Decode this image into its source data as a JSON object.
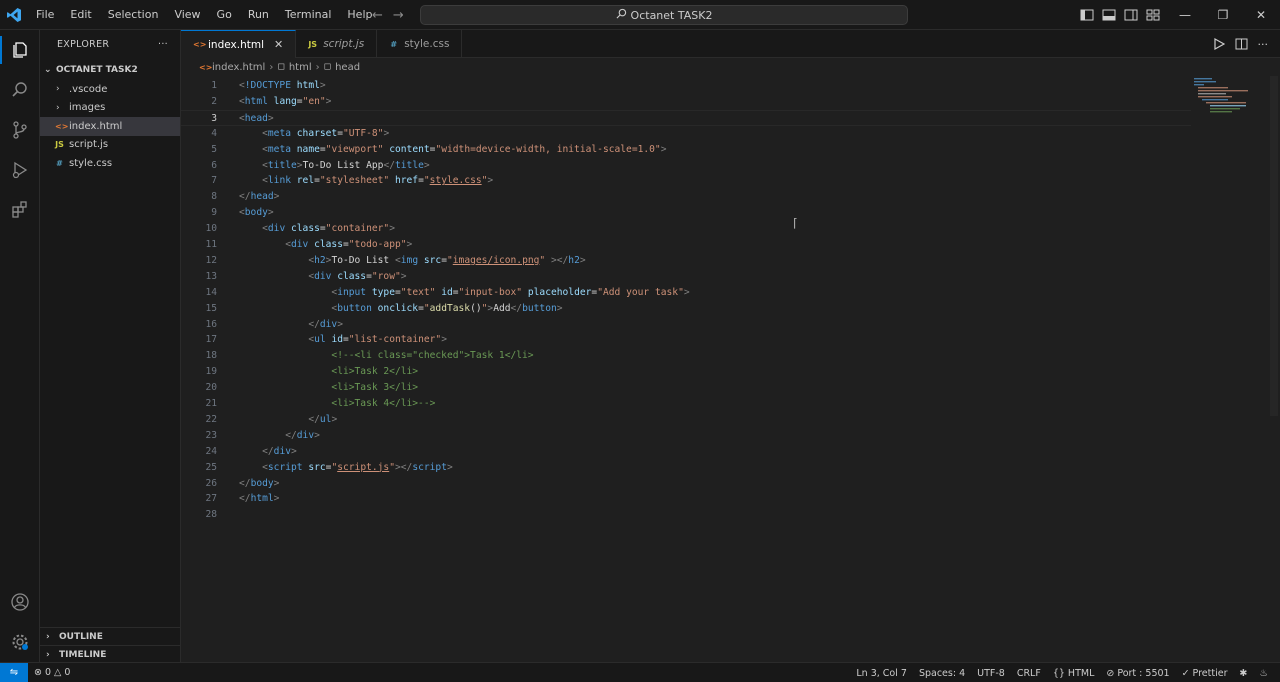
{
  "titlebar": {
    "menu": [
      "File",
      "Edit",
      "Selection",
      "View",
      "Go",
      "Run",
      "Terminal",
      "Help"
    ],
    "search_text": "Octanet TASK2"
  },
  "sidebar": {
    "title": "EXPLORER",
    "more": "···",
    "folder": "OCTANET TASK2",
    "items": [
      {
        "label": ".vscode",
        "kind": "folder"
      },
      {
        "label": "images",
        "kind": "folder"
      },
      {
        "label": "index.html",
        "kind": "html"
      },
      {
        "label": "script.js",
        "kind": "js"
      },
      {
        "label": "style.css",
        "kind": "css"
      }
    ],
    "outline": "OUTLINE",
    "timeline": "TIMELINE"
  },
  "tabs": [
    {
      "label": "index.html",
      "icon": "html",
      "active": true
    },
    {
      "label": "script.js",
      "icon": "js",
      "active": false
    },
    {
      "label": "style.css",
      "icon": "css",
      "active": false
    }
  ],
  "breadcrumb": [
    "index.html",
    "html",
    "head"
  ],
  "editor": {
    "lines": [
      [
        [
          "t-punc",
          "<"
        ],
        [
          "t-tag",
          "!DOCTYPE"
        ],
        [
          "t-txt",
          " "
        ],
        [
          "t-attr",
          "html"
        ],
        [
          "t-punc",
          ">"
        ]
      ],
      [
        [
          "t-punc",
          "<"
        ],
        [
          "t-tag",
          "html"
        ],
        [
          "t-txt",
          " "
        ],
        [
          "t-attr",
          "lang"
        ],
        [
          "t-txt",
          "="
        ],
        [
          "t-str",
          "\"en\""
        ],
        [
          "t-punc",
          ">"
        ]
      ],
      [
        [
          "t-punc",
          "<"
        ],
        [
          "t-tag",
          "head"
        ],
        [
          "t-punc",
          ">"
        ]
      ],
      [
        [
          "t-txt",
          "    "
        ],
        [
          "t-punc",
          "<"
        ],
        [
          "t-tag",
          "meta"
        ],
        [
          "t-txt",
          " "
        ],
        [
          "t-attr",
          "charset"
        ],
        [
          "t-txt",
          "="
        ],
        [
          "t-str",
          "\"UTF-8\""
        ],
        [
          "t-punc",
          ">"
        ]
      ],
      [
        [
          "t-txt",
          "    "
        ],
        [
          "t-punc",
          "<"
        ],
        [
          "t-tag",
          "meta"
        ],
        [
          "t-txt",
          " "
        ],
        [
          "t-attr",
          "name"
        ],
        [
          "t-txt",
          "="
        ],
        [
          "t-str",
          "\"viewport\""
        ],
        [
          "t-txt",
          " "
        ],
        [
          "t-attr",
          "content"
        ],
        [
          "t-txt",
          "="
        ],
        [
          "t-str",
          "\"width=device-width, initial-scale=1.0\""
        ],
        [
          "t-punc",
          ">"
        ]
      ],
      [
        [
          "t-txt",
          "    "
        ],
        [
          "t-punc",
          "<"
        ],
        [
          "t-tag",
          "title"
        ],
        [
          "t-punc",
          ">"
        ],
        [
          "t-txt",
          "To-Do List App"
        ],
        [
          "t-punc",
          "</"
        ],
        [
          "t-tag",
          "title"
        ],
        [
          "t-punc",
          ">"
        ]
      ],
      [
        [
          "t-txt",
          "    "
        ],
        [
          "t-punc",
          "<"
        ],
        [
          "t-tag",
          "link"
        ],
        [
          "t-txt",
          " "
        ],
        [
          "t-attr",
          "rel"
        ],
        [
          "t-txt",
          "="
        ],
        [
          "t-str",
          "\"stylesheet\""
        ],
        [
          "t-txt",
          " "
        ],
        [
          "t-attr",
          "href"
        ],
        [
          "t-txt",
          "="
        ],
        [
          "t-str",
          "\""
        ],
        [
          "t-str ul",
          "style.css"
        ],
        [
          "t-str",
          "\""
        ],
        [
          "t-punc",
          ">"
        ]
      ],
      [
        [
          "t-punc",
          "</"
        ],
        [
          "t-tag",
          "head"
        ],
        [
          "t-punc",
          ">"
        ]
      ],
      [
        [
          "t-punc",
          "<"
        ],
        [
          "t-tag",
          "body"
        ],
        [
          "t-punc",
          ">"
        ]
      ],
      [
        [
          "t-txt",
          "    "
        ],
        [
          "t-punc",
          "<"
        ],
        [
          "t-tag",
          "div"
        ],
        [
          "t-txt",
          " "
        ],
        [
          "t-attr",
          "class"
        ],
        [
          "t-txt",
          "="
        ],
        [
          "t-str",
          "\"container\""
        ],
        [
          "t-punc",
          ">"
        ]
      ],
      [
        [
          "t-txt",
          "        "
        ],
        [
          "t-punc",
          "<"
        ],
        [
          "t-tag",
          "div"
        ],
        [
          "t-txt",
          " "
        ],
        [
          "t-attr",
          "class"
        ],
        [
          "t-txt",
          "="
        ],
        [
          "t-str",
          "\"todo-app\""
        ],
        [
          "t-punc",
          ">"
        ]
      ],
      [
        [
          "t-txt",
          "            "
        ],
        [
          "t-punc",
          "<"
        ],
        [
          "t-tag",
          "h2"
        ],
        [
          "t-punc",
          ">"
        ],
        [
          "t-txt",
          "To-Do List "
        ],
        [
          "t-punc",
          "<"
        ],
        [
          "t-tag",
          "img"
        ],
        [
          "t-txt",
          " "
        ],
        [
          "t-attr",
          "src"
        ],
        [
          "t-txt",
          "="
        ],
        [
          "t-str",
          "\""
        ],
        [
          "t-str ul",
          "images/icon.png"
        ],
        [
          "t-str",
          "\""
        ],
        [
          "t-txt",
          " "
        ],
        [
          "t-punc",
          "></"
        ],
        [
          "t-tag",
          "h2"
        ],
        [
          "t-punc",
          ">"
        ]
      ],
      [
        [
          "t-txt",
          "            "
        ],
        [
          "t-punc",
          "<"
        ],
        [
          "t-tag",
          "div"
        ],
        [
          "t-txt",
          " "
        ],
        [
          "t-attr",
          "class"
        ],
        [
          "t-txt",
          "="
        ],
        [
          "t-str",
          "\"row\""
        ],
        [
          "t-punc",
          ">"
        ]
      ],
      [
        [
          "t-txt",
          "                "
        ],
        [
          "t-punc",
          "<"
        ],
        [
          "t-tag",
          "input"
        ],
        [
          "t-txt",
          " "
        ],
        [
          "t-attr",
          "type"
        ],
        [
          "t-txt",
          "="
        ],
        [
          "t-str",
          "\"text\""
        ],
        [
          "t-txt",
          " "
        ],
        [
          "t-attr",
          "id"
        ],
        [
          "t-txt",
          "="
        ],
        [
          "t-str",
          "\"input-box\""
        ],
        [
          "t-txt",
          " "
        ],
        [
          "t-attr",
          "placeholder"
        ],
        [
          "t-txt",
          "="
        ],
        [
          "t-str",
          "\"Add your task\""
        ],
        [
          "t-punc",
          ">"
        ]
      ],
      [
        [
          "t-txt",
          "                "
        ],
        [
          "t-punc",
          "<"
        ],
        [
          "t-tag",
          "button"
        ],
        [
          "t-txt",
          " "
        ],
        [
          "t-attr",
          "onclick"
        ],
        [
          "t-txt",
          "="
        ],
        [
          "t-str",
          "\""
        ],
        [
          "t-fn",
          "addTask"
        ],
        [
          "t-txt",
          "()"
        ],
        [
          "t-str",
          "\""
        ],
        [
          "t-punc",
          ">"
        ],
        [
          "t-txt",
          "Add"
        ],
        [
          "t-punc",
          "</"
        ],
        [
          "t-tag",
          "button"
        ],
        [
          "t-punc",
          ">"
        ]
      ],
      [
        [
          "t-txt",
          "            "
        ],
        [
          "t-punc",
          "</"
        ],
        [
          "t-tag",
          "div"
        ],
        [
          "t-punc",
          ">"
        ]
      ],
      [
        [
          "t-txt",
          "            "
        ],
        [
          "t-punc",
          "<"
        ],
        [
          "t-tag",
          "ul"
        ],
        [
          "t-txt",
          " "
        ],
        [
          "t-attr",
          "id"
        ],
        [
          "t-txt",
          "="
        ],
        [
          "t-str",
          "\"list-container\""
        ],
        [
          "t-punc",
          ">"
        ]
      ],
      [
        [
          "t-txt",
          "                "
        ],
        [
          "t-cmt",
          "<!--<li class=\"checked\">Task 1</li>"
        ]
      ],
      [
        [
          "t-txt",
          "                "
        ],
        [
          "t-cmt",
          "<li>Task 2</li>"
        ]
      ],
      [
        [
          "t-txt",
          "                "
        ],
        [
          "t-cmt",
          "<li>Task 3</li>"
        ]
      ],
      [
        [
          "t-txt",
          "                "
        ],
        [
          "t-cmt",
          "<li>Task 4</li>-->"
        ]
      ],
      [
        [
          "t-txt",
          "            "
        ],
        [
          "t-punc",
          "</"
        ],
        [
          "t-tag",
          "ul"
        ],
        [
          "t-punc",
          ">"
        ]
      ],
      [
        [
          "t-txt",
          "        "
        ],
        [
          "t-punc",
          "</"
        ],
        [
          "t-tag",
          "div"
        ],
        [
          "t-punc",
          ">"
        ]
      ],
      [
        [
          "t-txt",
          "    "
        ],
        [
          "t-punc",
          "</"
        ],
        [
          "t-tag",
          "div"
        ],
        [
          "t-punc",
          ">"
        ]
      ],
      [
        [
          "t-txt",
          "    "
        ],
        [
          "t-punc",
          "<"
        ],
        [
          "t-tag",
          "script"
        ],
        [
          "t-txt",
          " "
        ],
        [
          "t-attr",
          "src"
        ],
        [
          "t-txt",
          "="
        ],
        [
          "t-str",
          "\""
        ],
        [
          "t-str ul",
          "script.js"
        ],
        [
          "t-str",
          "\""
        ],
        [
          "t-punc",
          "></"
        ],
        [
          "t-tag",
          "script"
        ],
        [
          "t-punc",
          ">"
        ]
      ],
      [
        [
          "t-punc",
          "</"
        ],
        [
          "t-tag",
          "body"
        ],
        [
          "t-punc",
          ">"
        ]
      ],
      [
        [
          "t-punc",
          "</"
        ],
        [
          "t-tag",
          "html"
        ],
        [
          "t-punc",
          ">"
        ]
      ],
      [
        [
          "t-txt",
          ""
        ]
      ]
    ],
    "current_line": 3
  },
  "status": {
    "errors": "0",
    "warnings": "0",
    "position": "Ln 3, Col 7",
    "spaces": "Spaces: 4",
    "encoding": "UTF-8",
    "eol": "CRLF",
    "language": "HTML",
    "port": "Port : 5501",
    "prettier": "Prettier"
  },
  "colors": {
    "accent": "#0078d4",
    "tag": "#569cd6",
    "attr": "#9cdcfe",
    "string": "#ce9178",
    "comment": "#6a9955"
  }
}
